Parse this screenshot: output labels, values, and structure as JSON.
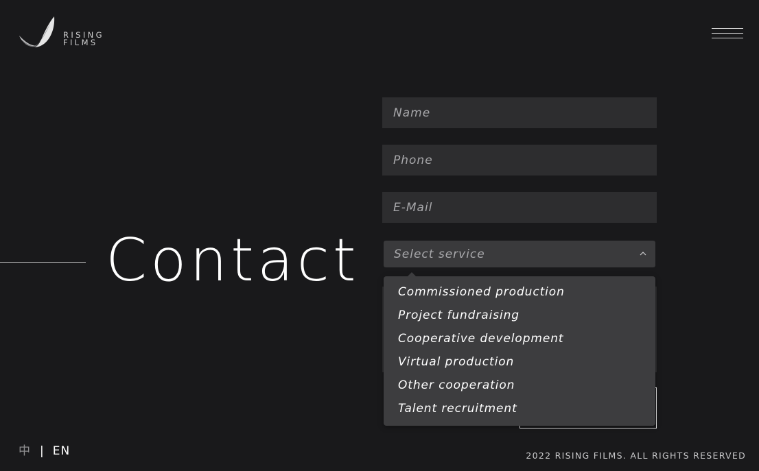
{
  "brand": {
    "line1": "RISING",
    "line2": "FILMS"
  },
  "heading": "Contact",
  "form": {
    "name_placeholder": "Name",
    "phone_placeholder": "Phone",
    "email_placeholder": "E-Mail",
    "service_placeholder": "Select service",
    "service_options": [
      "Commissioned production",
      "Project fundraising",
      "Cooperative development",
      "Virtual production",
      "Other cooperation",
      "Talent recruitment"
    ]
  },
  "language": {
    "zh": "中",
    "separator": "|",
    "en": "EN"
  },
  "footer": {
    "copyright": "2022 RISING FILMS. ALL RIGHTS RESERVED"
  },
  "icons": {
    "logo": "wing-logo-icon",
    "menu": "hamburger-menu-icon",
    "select_arrow": "chevron-up-icon"
  },
  "colors": {
    "background": "#19191b",
    "field": "#2d2d2f",
    "dropdown": "#3d3d3f",
    "text": "#ffffff",
    "placeholder": "#a7a7aa"
  }
}
